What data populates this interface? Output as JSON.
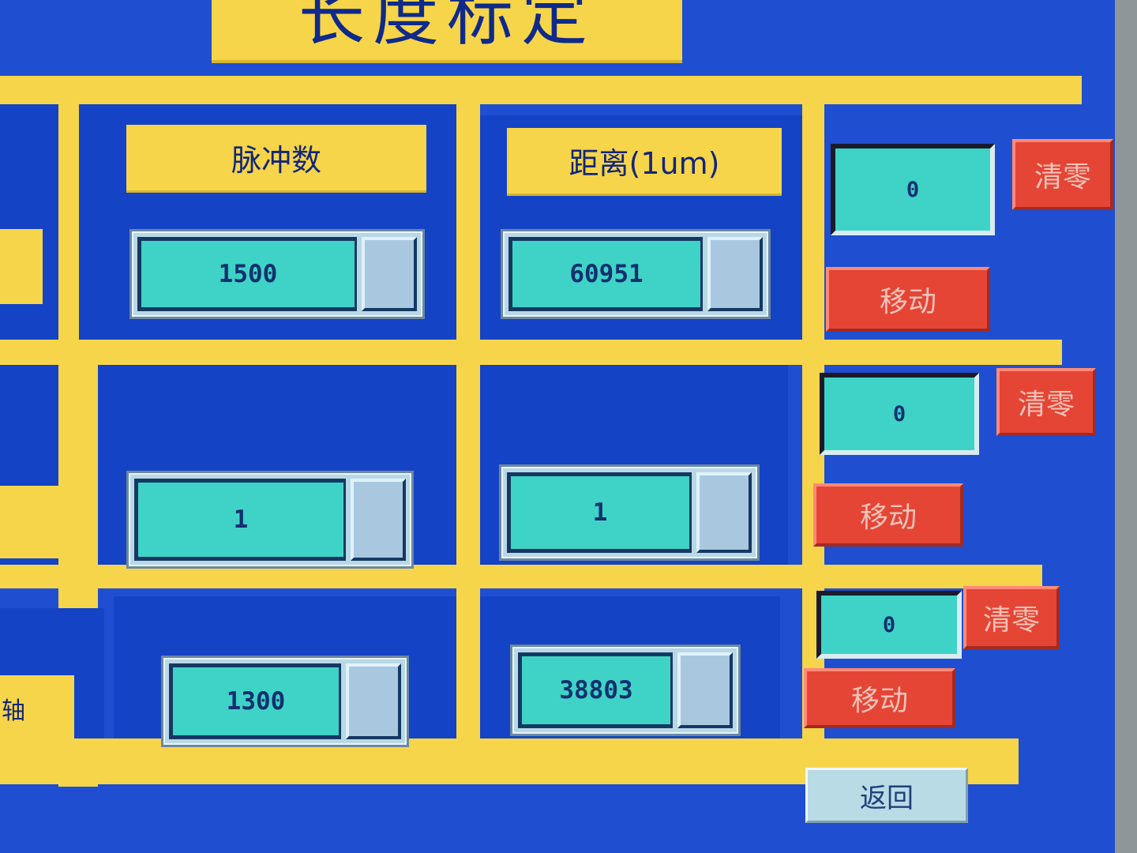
{
  "title": "长度标定",
  "headers": {
    "pulse": "脉冲数",
    "distance": "距离(1um)"
  },
  "rows": [
    {
      "pulse": "1500",
      "distance": "60951",
      "readout": "0",
      "clear_label": "清零",
      "move_label": "移动"
    },
    {
      "pulse": "1",
      "distance": "1",
      "readout": "0",
      "clear_label": "清零",
      "move_label": "移动"
    },
    {
      "pulse": "1300",
      "distance": "38803",
      "readout": "0",
      "clear_label": "清零",
      "move_label": "移动"
    }
  ],
  "return_label": "返回",
  "left_partial_label": "轴",
  "colors": {
    "background": "#1f4fd0",
    "panel": "#1443c6",
    "frame": "#f6d54a",
    "field": "#3ed3c6",
    "button_red": "#e54535"
  }
}
